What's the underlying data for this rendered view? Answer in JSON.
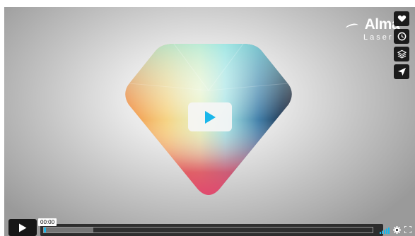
{
  "brand": {
    "name": "Alma",
    "sub": "Lasers"
  },
  "player": {
    "time": "00:00",
    "progress": 0.005,
    "buffered": 0.15
  },
  "sidebar": {
    "buttons": [
      "like",
      "watch-later",
      "collections",
      "share"
    ]
  },
  "colors": {
    "accent": "#1ab7ea",
    "button_bg": "#1b1b1b"
  }
}
